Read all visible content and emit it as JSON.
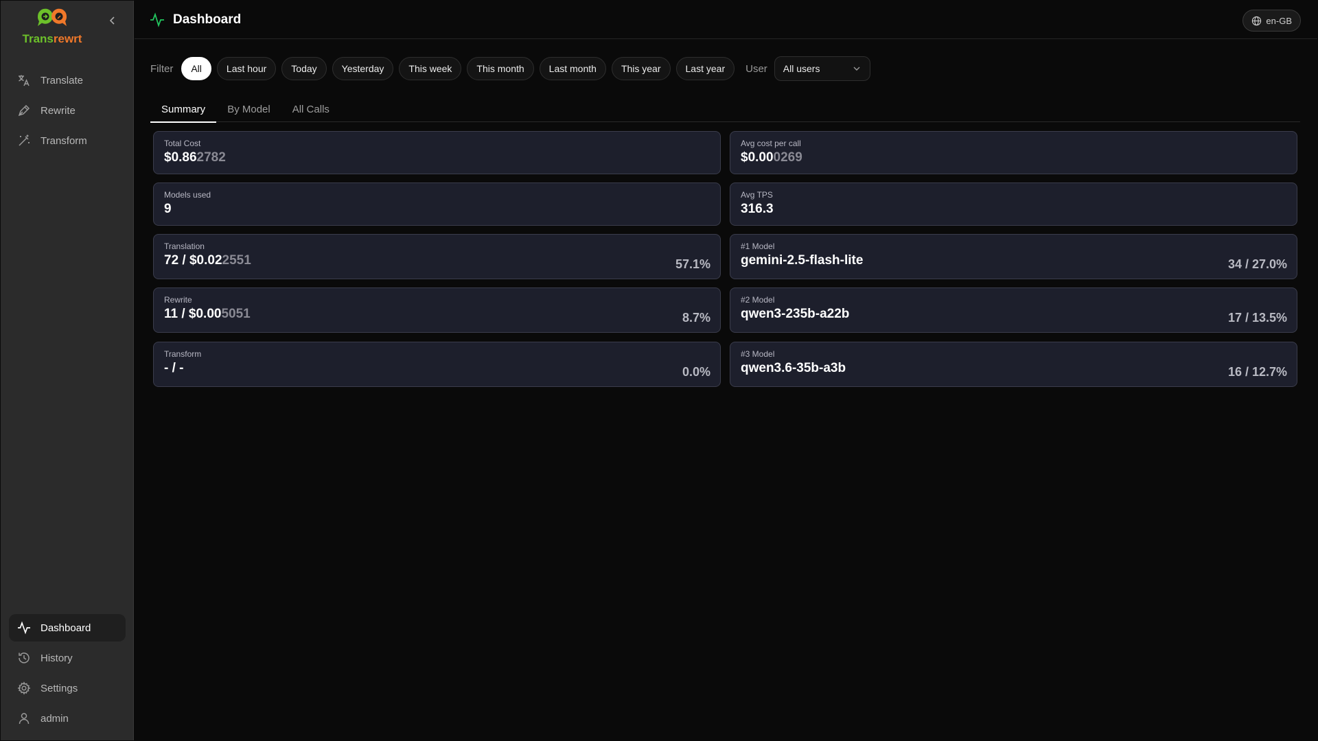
{
  "brand": {
    "name_part1": "Trans",
    "name_part2": "rewrt"
  },
  "sidebar": {
    "top_items": [
      {
        "label": "Translate",
        "icon": "translate-icon"
      },
      {
        "label": "Rewrite",
        "icon": "pen-icon"
      },
      {
        "label": "Transform",
        "icon": "wand-icon"
      }
    ],
    "bottom_items": [
      {
        "label": "Dashboard",
        "icon": "activity-icon",
        "active": true
      },
      {
        "label": "History",
        "icon": "history-icon"
      },
      {
        "label": "Settings",
        "icon": "gear-icon"
      },
      {
        "label": "admin",
        "icon": "user-icon"
      }
    ]
  },
  "header": {
    "title": "Dashboard",
    "locale": "en-GB"
  },
  "filter": {
    "label": "Filter",
    "options": [
      "All",
      "Last hour",
      "Today",
      "Yesterday",
      "This week",
      "This month",
      "Last month",
      "This year",
      "Last year"
    ],
    "selected": "All",
    "user_label": "User",
    "user_value": "All users"
  },
  "tabs": [
    "Summary",
    "By Model",
    "All Calls"
  ],
  "active_tab": "Summary",
  "cards": {
    "total_cost": {
      "label": "Total Cost",
      "main": "$0.86",
      "dim": "2782"
    },
    "avg_cost": {
      "label": "Avg cost per call",
      "main": "$0.00",
      "dim": "0269"
    },
    "models_used": {
      "label": "Models used",
      "value": "9"
    },
    "avg_tps": {
      "label": "Avg TPS",
      "value": "316.3"
    },
    "translation": {
      "label": "Translation",
      "main": "72 / $0.02",
      "dim": "2551",
      "pct": "57.1%"
    },
    "rewrite": {
      "label": "Rewrite",
      "main": "11 / $0.00",
      "dim": "5051",
      "pct": "8.7%"
    },
    "transform": {
      "label": "Transform",
      "value": "- / -",
      "pct": "0.0%"
    },
    "model1": {
      "label": "#1 Model",
      "value": "gemini-2.5-flash-lite",
      "stat": "34 / 27.0%"
    },
    "model2": {
      "label": "#2 Model",
      "value": "qwen3-235b-a22b",
      "stat": "17 / 13.5%"
    },
    "model3": {
      "label": "#3 Model",
      "value": "qwen3.6-35b-a3b",
      "stat": "16 / 12.7%"
    }
  },
  "colors": {
    "accent_green": "#22c55e",
    "card_bg": "#1d1f2c",
    "brand_green": "#6cc02a",
    "brand_orange": "#f0782a"
  }
}
